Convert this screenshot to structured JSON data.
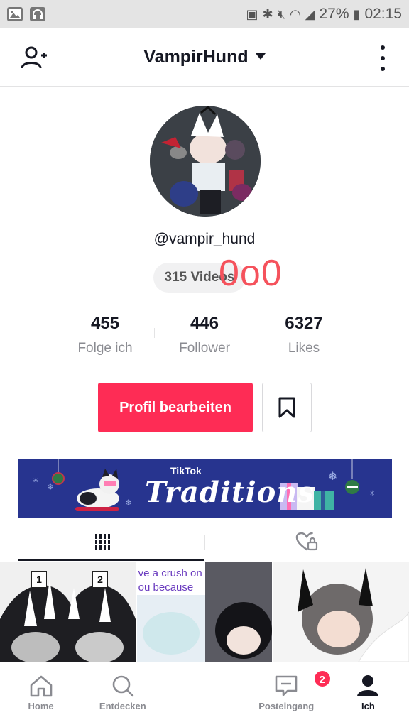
{
  "status_bar": {
    "battery": "27%",
    "time": "02:15"
  },
  "header": {
    "title": "VampirHund"
  },
  "profile": {
    "username": "@vampir_hund",
    "videos_label": "315 Videos",
    "overlay_text": "0o0"
  },
  "stats": [
    {
      "value": "455",
      "label": "Folge ich"
    },
    {
      "value": "446",
      "label": "Follower"
    },
    {
      "value": "6327",
      "label": "Likes"
    }
  ],
  "actions": {
    "edit_profile": "Profil bearbeiten"
  },
  "banner": {
    "small": "TikTok",
    "big": "Traditions"
  },
  "grid": {
    "cell1_tags": [
      "1",
      "2"
    ],
    "cell2_text": "ve a crush on\nou because"
  },
  "bottom_nav": {
    "home": "Home",
    "discover": "Entdecken",
    "inbox": "Posteingang",
    "inbox_badge": "2",
    "me": "Ich"
  },
  "colors": {
    "accent": "#fe2c55",
    "banner": "#27348f",
    "overlay": "#f5525c"
  }
}
